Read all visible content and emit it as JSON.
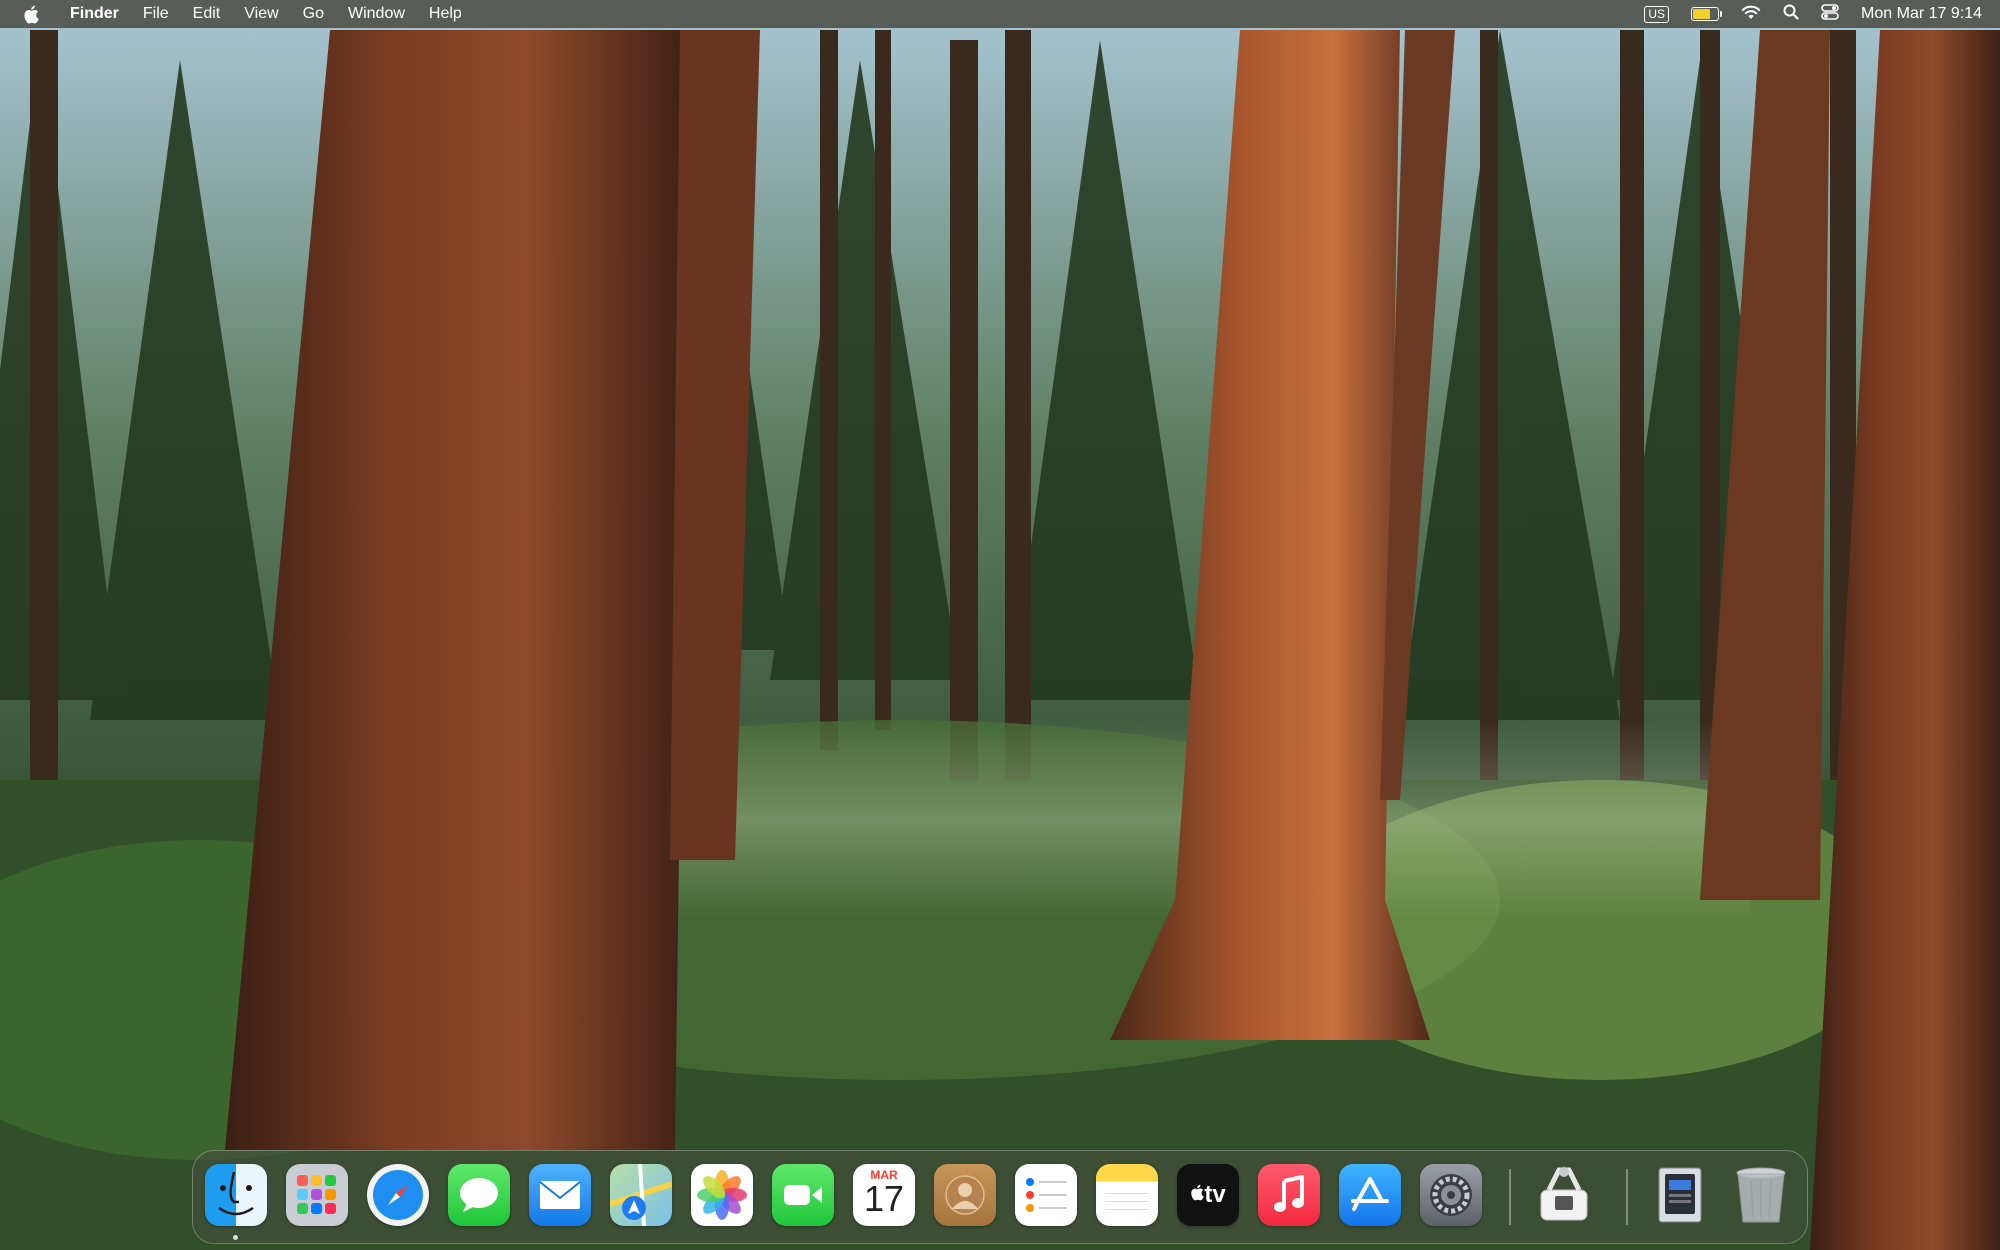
{
  "menubar": {
    "app_name": "Finder",
    "menus": [
      "File",
      "Edit",
      "View",
      "Go",
      "Window",
      "Help"
    ],
    "input_source": "US",
    "clock": "Mon Mar 17  9:14",
    "battery_level": 0.7,
    "battery_color": "#f5d02a"
  },
  "dock": {
    "apps": [
      {
        "name": "Finder",
        "icon": "finder-icon",
        "running": true
      },
      {
        "name": "Launchpad",
        "icon": "launchpad-icon"
      },
      {
        "name": "Safari",
        "icon": "safari-icon"
      },
      {
        "name": "Messages",
        "icon": "messages-icon"
      },
      {
        "name": "Mail",
        "icon": "mail-icon"
      },
      {
        "name": "Maps",
        "icon": "maps-icon"
      },
      {
        "name": "Photos",
        "icon": "photos-icon"
      },
      {
        "name": "FaceTime",
        "icon": "facetime-icon"
      },
      {
        "name": "Calendar",
        "icon": "calendar-icon",
        "month": "MAR",
        "day": "17"
      },
      {
        "name": "Contacts",
        "icon": "contacts-icon"
      },
      {
        "name": "Reminders",
        "icon": "reminders-icon"
      },
      {
        "name": "Notes",
        "icon": "notes-icon"
      },
      {
        "name": "TV",
        "icon": "tv-icon",
        "label": "tv"
      },
      {
        "name": "Music",
        "icon": "music-icon"
      },
      {
        "name": "App Store",
        "icon": "app-store-icon"
      },
      {
        "name": "System Settings",
        "icon": "system-settings-icon"
      },
      {
        "name": "Archive Utility",
        "icon": "archive-utility-icon"
      },
      {
        "name": "Downloads stack",
        "icon": "downloads-stack-icon"
      },
      {
        "name": "Trash",
        "icon": "trash-icon"
      }
    ]
  }
}
